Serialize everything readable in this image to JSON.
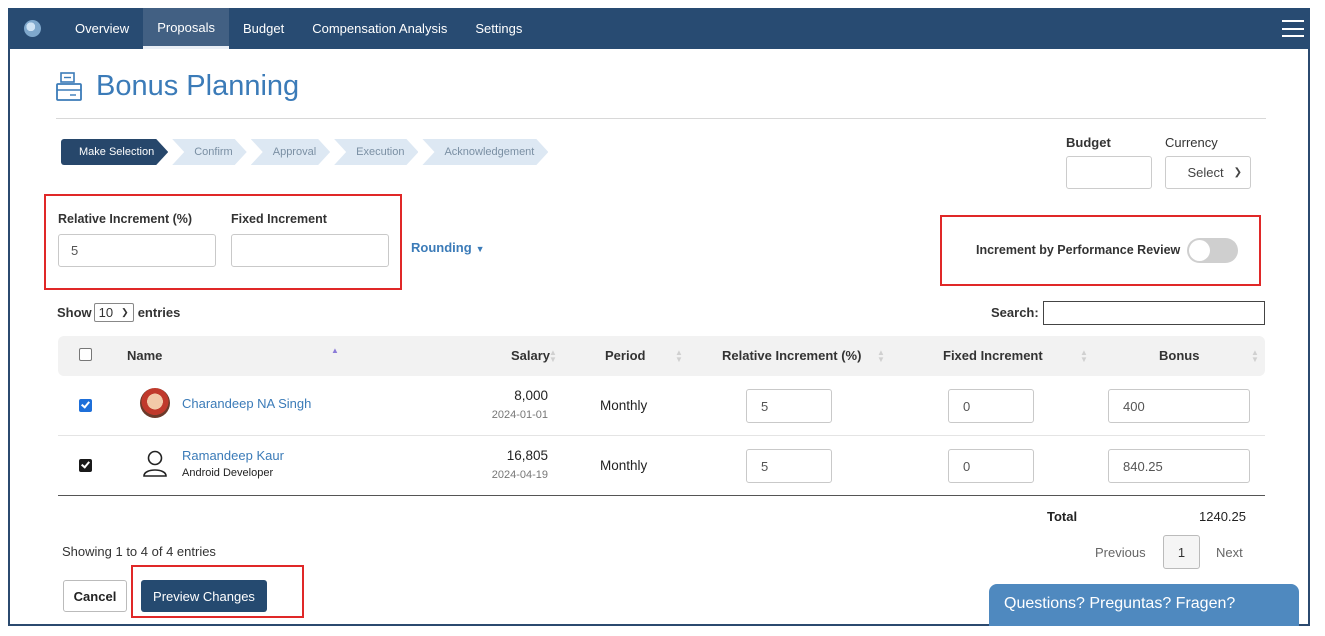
{
  "nav": {
    "items": [
      {
        "label": "Overview"
      },
      {
        "label": "Proposals",
        "active": true
      },
      {
        "label": "Budget"
      },
      {
        "label": "Compensation Analysis"
      },
      {
        "label": "Settings"
      }
    ]
  },
  "page": {
    "title": "Bonus Planning"
  },
  "stepper": [
    "Make Selection",
    "Confirm",
    "Approval",
    "Execution",
    "Acknowledgement"
  ],
  "budget": {
    "label": "Budget",
    "value": ""
  },
  "currency": {
    "label": "Currency",
    "value": "Select"
  },
  "increment": {
    "relative_label": "Relative Increment (%)",
    "relative_value": "5",
    "fixed_label": "Fixed Increment",
    "fixed_value": "",
    "rounding_label": "Rounding"
  },
  "performance_review": {
    "label": "Increment by Performance Review",
    "enabled": false
  },
  "table_controls": {
    "show": "Show",
    "entries_value": "10",
    "entries": "entries",
    "search_label": "Search:",
    "search_value": ""
  },
  "table": {
    "headers": {
      "name": "Name",
      "salary": "Salary",
      "period": "Period",
      "relative": "Relative Increment (%)",
      "fixed": "Fixed Increment",
      "bonus": "Bonus"
    },
    "rows": [
      {
        "name": "Charandeep NA Singh",
        "role": "",
        "salary": "8,000",
        "date": "2024-01-01",
        "period": "Monthly",
        "relative": "5",
        "fixed": "0",
        "bonus": "400",
        "checked": true
      },
      {
        "name": "Ramandeep Kaur",
        "role": "Android Developer",
        "salary": "16,805",
        "date": "2024-04-19",
        "period": "Monthly",
        "relative": "5",
        "fixed": "0",
        "bonus": "840.25",
        "checked": true
      }
    ],
    "total_label": "Total",
    "total_value": "1240.25"
  },
  "pagination": {
    "summary": "Showing 1 to 4 of 4 entries",
    "previous": "Previous",
    "page": "1",
    "next": "Next"
  },
  "actions": {
    "cancel": "Cancel",
    "preview": "Preview Changes"
  },
  "help_widget": {
    "label": "Questions? Preguntas? Fragen?"
  },
  "colors": {
    "nav_bg": "#284b72",
    "accent": "#3b7bb8",
    "highlight": "#e02828",
    "primary_button": "#254a70"
  }
}
